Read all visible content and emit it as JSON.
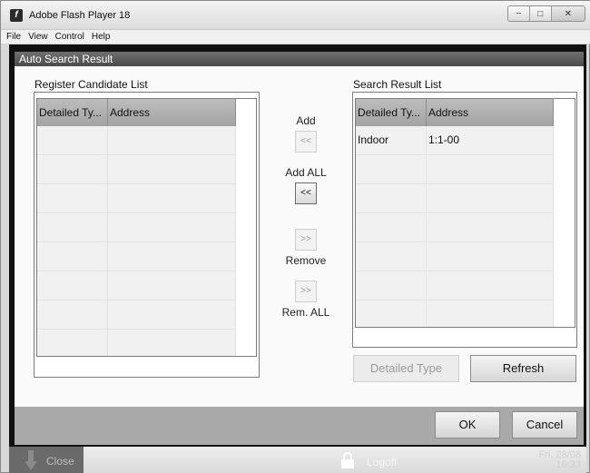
{
  "window": {
    "title": "Adobe Flash Player 18"
  },
  "menu": [
    "File",
    "View",
    "Control",
    "Help"
  ],
  "panel": {
    "title": "Auto Search Result"
  },
  "register": {
    "label": "Register Candidate List",
    "columns": [
      "Detailed Ty...",
      "Address"
    ],
    "rows": []
  },
  "search": {
    "label": "Search Result List",
    "columns": [
      "Detailed Ty...",
      "Address"
    ],
    "rows": [
      {
        "type": "Indoor",
        "address": "1:1-00"
      }
    ]
  },
  "middle": {
    "add_label": "Add",
    "add_btn": "<<",
    "add_all_label": "Add ALL",
    "add_all_btn": "<<",
    "remove_btn": ">>",
    "remove_label": "Remove",
    "rem_all_btn": ">>",
    "rem_all_label": "Rem. ALL"
  },
  "buttons": {
    "detailed_type": "Detailed Type",
    "refresh": "Refresh",
    "ok": "OK",
    "cancel": "Cancel"
  },
  "bottombar": {
    "close": "Close",
    "logoff": "Logoff",
    "date": "Fri, 28/08",
    "time": "16:33"
  }
}
